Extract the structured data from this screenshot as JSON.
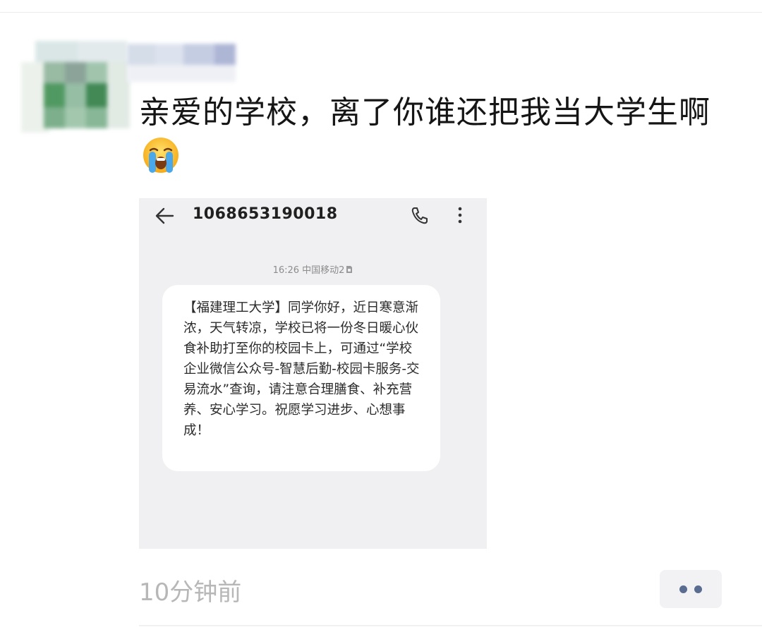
{
  "post": {
    "text": "亲爱的学校，离了你谁还把我当大学生啊",
    "emoji_icon": "loudly-crying-face-icon",
    "timestamp": "10分钟前"
  },
  "sms": {
    "phone_number": "1068653190018",
    "meta": "16:26 中国移动2",
    "message": "【福建理工大学】同学你好，近日寒意渐浓，天气转凉，学校已将一份冬日暖心伙食补助打至你的校园卡上，可通过“学校企业微信公众号-智慧后勤-校园卡服务-交易流水”查询，请注意合理膳食、补充营养、安心学习。祝愿学习进步、心想事成！"
  },
  "colors": {
    "accent_dots": "#5a6c8f",
    "timestamp": "#b7b7b7",
    "sms_background": "#f0f0f3"
  }
}
